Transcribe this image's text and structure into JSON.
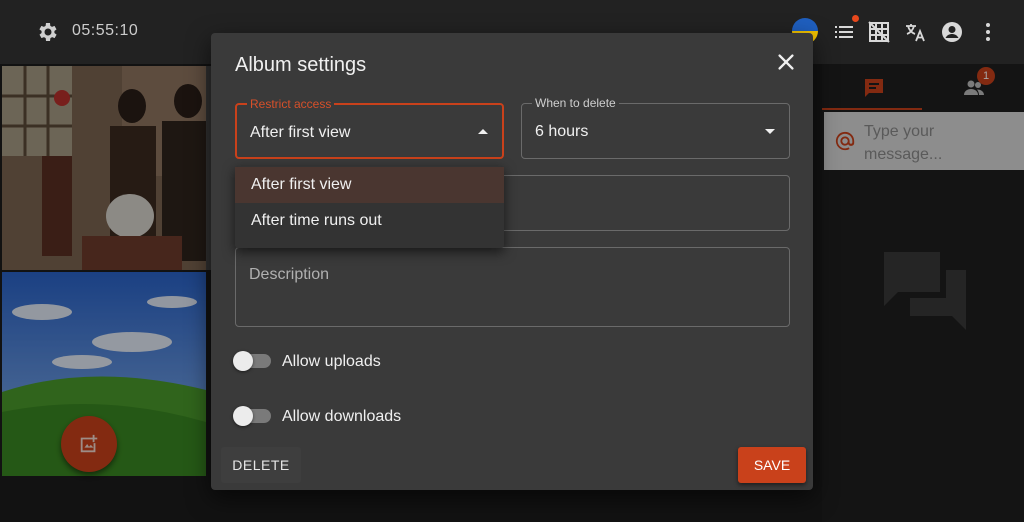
{
  "topbar": {
    "clock": "05:55:10",
    "icons": [
      "gear-icon",
      "flag-icon",
      "list-icon",
      "grid-off-icon",
      "translate-icon",
      "account-icon",
      "more-vert-icon"
    ]
  },
  "side_panel": {
    "badge_count": "1",
    "message_placeholder": "Type your message..."
  },
  "dialog": {
    "title": "Album settings",
    "restrict_access": {
      "label": "Restrict access",
      "value": "After first view",
      "options": [
        "After first view",
        "After time runs out"
      ]
    },
    "when_to_delete": {
      "label": "When to delete",
      "value": "6 hours"
    },
    "description_placeholder": "Description",
    "allow_uploads_label": "Allow uploads",
    "allow_downloads_label": "Allow downloads",
    "delete_label": "DELETE",
    "save_label": "SAVE"
  },
  "colors": {
    "accent": "#c9411b",
    "dialog_bg": "#3a3a3a",
    "page_bg": "#1c1c1c"
  }
}
